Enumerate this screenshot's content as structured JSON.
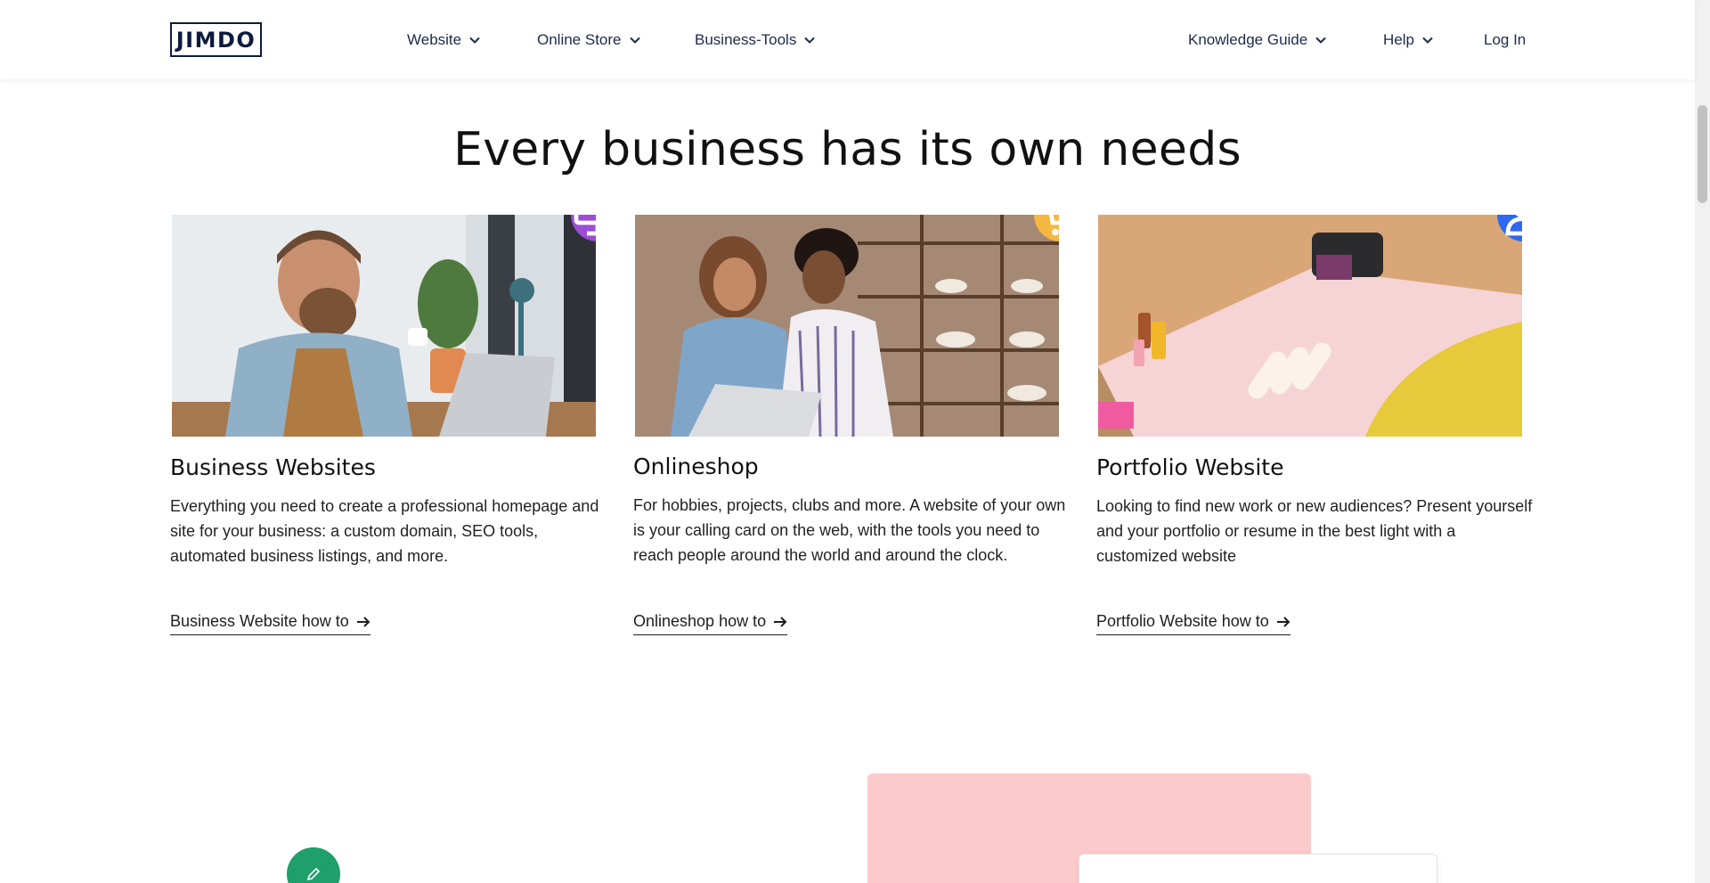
{
  "header": {
    "logo_text": "JIMDO",
    "nav_left": [
      {
        "label": "Website"
      },
      {
        "label": "Online Store"
      },
      {
        "label": "Business-Tools"
      }
    ],
    "nav_right": [
      {
        "label": "Knowledge Guide"
      },
      {
        "label": "Help"
      }
    ],
    "login_label": "Log In"
  },
  "main": {
    "section_title": "Every business has its own needs",
    "cards": [
      {
        "title": "Business Websites",
        "text": "Everything you need to create a professional homepage and site for your business: a custom domain, SEO tools, automated business listings, and more.",
        "link": "Business Website how to",
        "badge_icon": "monitor-icon",
        "badge_color": "#9b4dd6"
      },
      {
        "title": "Onlineshop",
        "text": "For hobbies, projects, clubs and more. A website of your own is your calling card on the web, with the tools you need to reach people around the world and around the clock.",
        "link": "Onlineshop how to",
        "badge_icon": "cart-icon",
        "badge_color": "#f4b73f"
      },
      {
        "title": "Portfolio Website",
        "text": "Looking to find new work or new audiences? Present yourself and your portfolio or resume in the best light with a customized website",
        "link": "Portfolio Website how to",
        "badge_icon": "person-icon",
        "badge_color": "#2f68f0"
      }
    ]
  },
  "lower": {
    "badge_icon": "pencil-icon",
    "badge_color": "#1f9f6b",
    "panel_color": "#fccaca"
  }
}
